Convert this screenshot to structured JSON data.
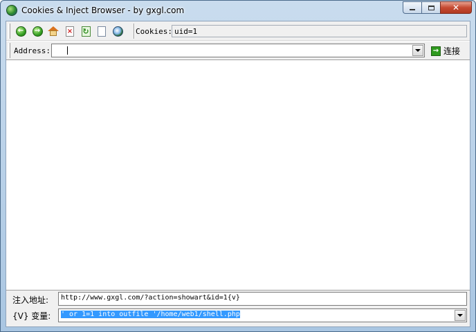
{
  "window": {
    "title": "Cookies & Inject Browser - by gxgl.com",
    "controls": {
      "minimize": "minimize",
      "maximize": "maximize",
      "close": "✕"
    }
  },
  "toolbar": {
    "icons": [
      "back-icon",
      "forward-icon",
      "home-icon",
      "stop-icon",
      "refresh-icon",
      "new-page-icon",
      "globe-icon"
    ],
    "cookies_label": "Cookies:",
    "cookies_value": "uid=1"
  },
  "addressbar": {
    "label": "Address:",
    "value": "",
    "go_label": "连接"
  },
  "inject": {
    "url_label": "注入地址:",
    "url_value": "http://www.gxgl.com/?action=showart&id=1{v}",
    "var_label": "{V} 变量:",
    "var_value": "' or 1=1 into outfile '/home/web1/shell.php"
  },
  "colors": {
    "title_gradient_top": "#c9dcee",
    "selection": "#3399ff",
    "close_button": "#c64a32"
  }
}
